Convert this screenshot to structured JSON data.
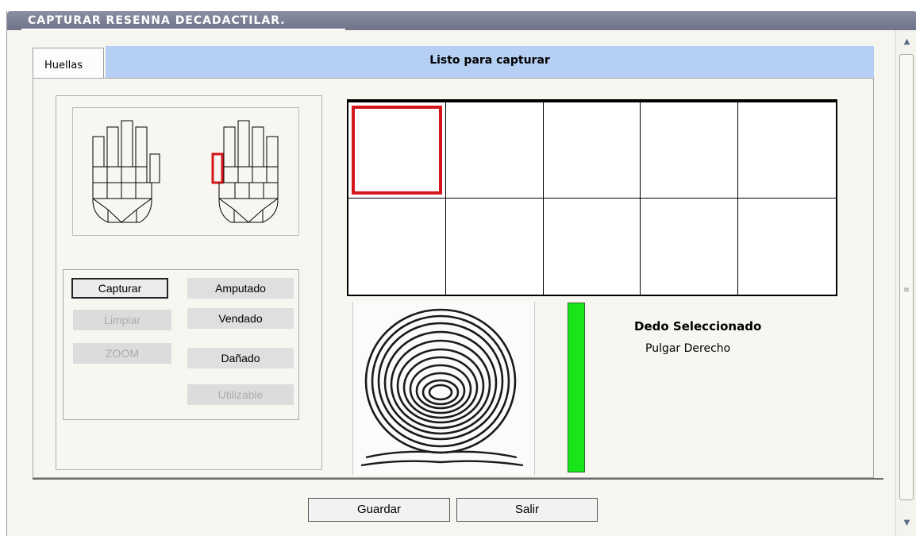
{
  "window": {
    "title": "CAPTURAR RESENNA DECADACTILAR."
  },
  "tabs": [
    {
      "label": "Huellas",
      "active": true
    }
  ],
  "status": {
    "text": "Listo para capturar",
    "color": "#b5cff5"
  },
  "hand_diagram": {
    "selected_finger": "right-thumb",
    "highlight_color": "#d4151c"
  },
  "buttons": {
    "capturar": "Capturar",
    "limpiar": "Limpiar",
    "zoom": "ZOOM",
    "amputado": "Amputado",
    "vendado": "Vendado",
    "danado": "Dañado",
    "utilizable": "Utilizable"
  },
  "finger_grid": {
    "rows": 2,
    "cols": 5,
    "selected_index": 0,
    "selection_color": "#d4151c"
  },
  "quality": {
    "level": 1.0,
    "color": "#19e619"
  },
  "selected_finger": {
    "title": "Dedo Seleccionado",
    "value": "Pulgar Derecho"
  },
  "footer": {
    "guardar": "Guardar",
    "salir": "Salir"
  },
  "icons": {
    "scroll_up": "scroll-up-arrow-icon",
    "scroll_down": "scroll-down-arrow-icon",
    "grip": "scrollbar-grip-icon"
  }
}
